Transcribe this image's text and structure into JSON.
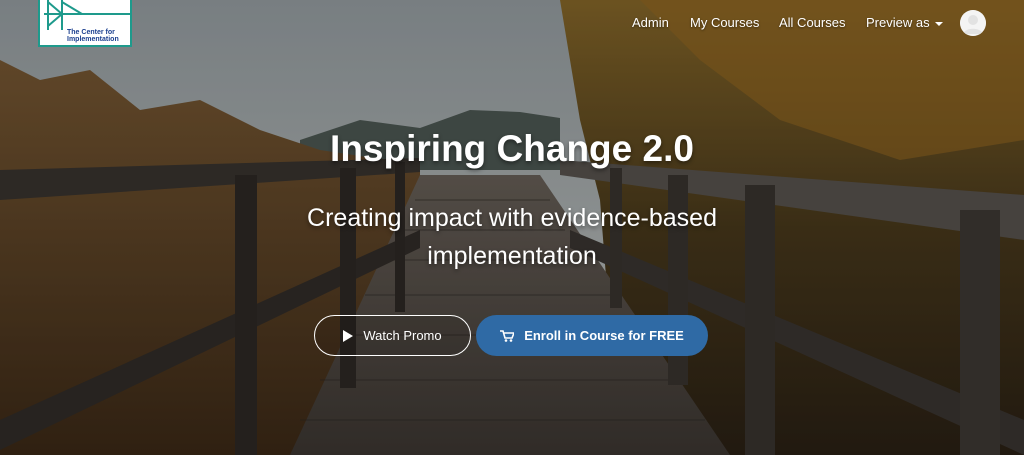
{
  "logo": {
    "text": "The Center for Implementation"
  },
  "nav": {
    "items": [
      {
        "label": "Admin"
      },
      {
        "label": "My Courses"
      },
      {
        "label": "All Courses"
      },
      {
        "label": "Preview as"
      }
    ],
    "avatar_icon": "user-avatar-icon"
  },
  "hero": {
    "title": "Inspiring Change 2.0",
    "subtitle": "Creating impact with evidence-based implementation",
    "watch_promo_label": "Watch Promo",
    "enroll_label": "Enroll in Course for FREE"
  },
  "colors": {
    "enroll_button": "#2f6aa5",
    "logo_accent": "#1e9a8c",
    "logo_text": "#1b3f8f"
  }
}
